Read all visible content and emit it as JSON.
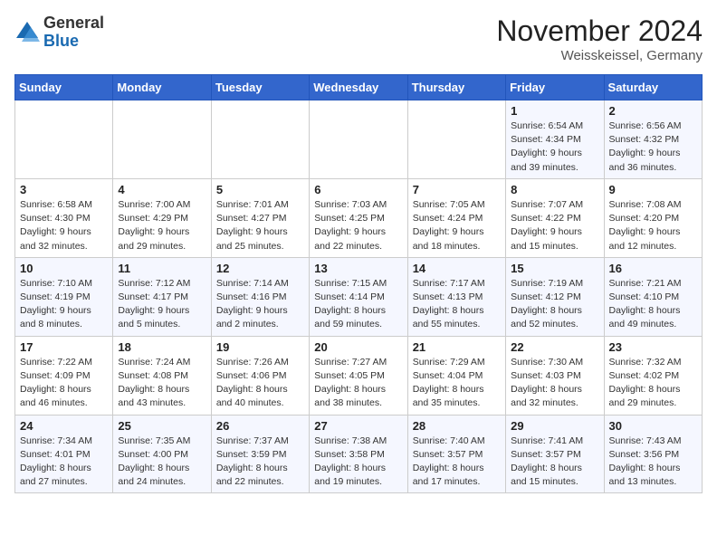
{
  "header": {
    "logo_general": "General",
    "logo_blue": "Blue",
    "month_title": "November 2024",
    "location": "Weisskeissel, Germany"
  },
  "days_of_week": [
    "Sunday",
    "Monday",
    "Tuesday",
    "Wednesday",
    "Thursday",
    "Friday",
    "Saturday"
  ],
  "weeks": [
    [
      {
        "day": "",
        "detail": ""
      },
      {
        "day": "",
        "detail": ""
      },
      {
        "day": "",
        "detail": ""
      },
      {
        "day": "",
        "detail": ""
      },
      {
        "day": "",
        "detail": ""
      },
      {
        "day": "1",
        "detail": "Sunrise: 6:54 AM\nSunset: 4:34 PM\nDaylight: 9 hours\nand 39 minutes."
      },
      {
        "day": "2",
        "detail": "Sunrise: 6:56 AM\nSunset: 4:32 PM\nDaylight: 9 hours\nand 36 minutes."
      }
    ],
    [
      {
        "day": "3",
        "detail": "Sunrise: 6:58 AM\nSunset: 4:30 PM\nDaylight: 9 hours\nand 32 minutes."
      },
      {
        "day": "4",
        "detail": "Sunrise: 7:00 AM\nSunset: 4:29 PM\nDaylight: 9 hours\nand 29 minutes."
      },
      {
        "day": "5",
        "detail": "Sunrise: 7:01 AM\nSunset: 4:27 PM\nDaylight: 9 hours\nand 25 minutes."
      },
      {
        "day": "6",
        "detail": "Sunrise: 7:03 AM\nSunset: 4:25 PM\nDaylight: 9 hours\nand 22 minutes."
      },
      {
        "day": "7",
        "detail": "Sunrise: 7:05 AM\nSunset: 4:24 PM\nDaylight: 9 hours\nand 18 minutes."
      },
      {
        "day": "8",
        "detail": "Sunrise: 7:07 AM\nSunset: 4:22 PM\nDaylight: 9 hours\nand 15 minutes."
      },
      {
        "day": "9",
        "detail": "Sunrise: 7:08 AM\nSunset: 4:20 PM\nDaylight: 9 hours\nand 12 minutes."
      }
    ],
    [
      {
        "day": "10",
        "detail": "Sunrise: 7:10 AM\nSunset: 4:19 PM\nDaylight: 9 hours\nand 8 minutes."
      },
      {
        "day": "11",
        "detail": "Sunrise: 7:12 AM\nSunset: 4:17 PM\nDaylight: 9 hours\nand 5 minutes."
      },
      {
        "day": "12",
        "detail": "Sunrise: 7:14 AM\nSunset: 4:16 PM\nDaylight: 9 hours\nand 2 minutes."
      },
      {
        "day": "13",
        "detail": "Sunrise: 7:15 AM\nSunset: 4:14 PM\nDaylight: 8 hours\nand 59 minutes."
      },
      {
        "day": "14",
        "detail": "Sunrise: 7:17 AM\nSunset: 4:13 PM\nDaylight: 8 hours\nand 55 minutes."
      },
      {
        "day": "15",
        "detail": "Sunrise: 7:19 AM\nSunset: 4:12 PM\nDaylight: 8 hours\nand 52 minutes."
      },
      {
        "day": "16",
        "detail": "Sunrise: 7:21 AM\nSunset: 4:10 PM\nDaylight: 8 hours\nand 49 minutes."
      }
    ],
    [
      {
        "day": "17",
        "detail": "Sunrise: 7:22 AM\nSunset: 4:09 PM\nDaylight: 8 hours\nand 46 minutes."
      },
      {
        "day": "18",
        "detail": "Sunrise: 7:24 AM\nSunset: 4:08 PM\nDaylight: 8 hours\nand 43 minutes."
      },
      {
        "day": "19",
        "detail": "Sunrise: 7:26 AM\nSunset: 4:06 PM\nDaylight: 8 hours\nand 40 minutes."
      },
      {
        "day": "20",
        "detail": "Sunrise: 7:27 AM\nSunset: 4:05 PM\nDaylight: 8 hours\nand 38 minutes."
      },
      {
        "day": "21",
        "detail": "Sunrise: 7:29 AM\nSunset: 4:04 PM\nDaylight: 8 hours\nand 35 minutes."
      },
      {
        "day": "22",
        "detail": "Sunrise: 7:30 AM\nSunset: 4:03 PM\nDaylight: 8 hours\nand 32 minutes."
      },
      {
        "day": "23",
        "detail": "Sunrise: 7:32 AM\nSunset: 4:02 PM\nDaylight: 8 hours\nand 29 minutes."
      }
    ],
    [
      {
        "day": "24",
        "detail": "Sunrise: 7:34 AM\nSunset: 4:01 PM\nDaylight: 8 hours\nand 27 minutes."
      },
      {
        "day": "25",
        "detail": "Sunrise: 7:35 AM\nSunset: 4:00 PM\nDaylight: 8 hours\nand 24 minutes."
      },
      {
        "day": "26",
        "detail": "Sunrise: 7:37 AM\nSunset: 3:59 PM\nDaylight: 8 hours\nand 22 minutes."
      },
      {
        "day": "27",
        "detail": "Sunrise: 7:38 AM\nSunset: 3:58 PM\nDaylight: 8 hours\nand 19 minutes."
      },
      {
        "day": "28",
        "detail": "Sunrise: 7:40 AM\nSunset: 3:57 PM\nDaylight: 8 hours\nand 17 minutes."
      },
      {
        "day": "29",
        "detail": "Sunrise: 7:41 AM\nSunset: 3:57 PM\nDaylight: 8 hours\nand 15 minutes."
      },
      {
        "day": "30",
        "detail": "Sunrise: 7:43 AM\nSunset: 3:56 PM\nDaylight: 8 hours\nand 13 minutes."
      }
    ]
  ]
}
